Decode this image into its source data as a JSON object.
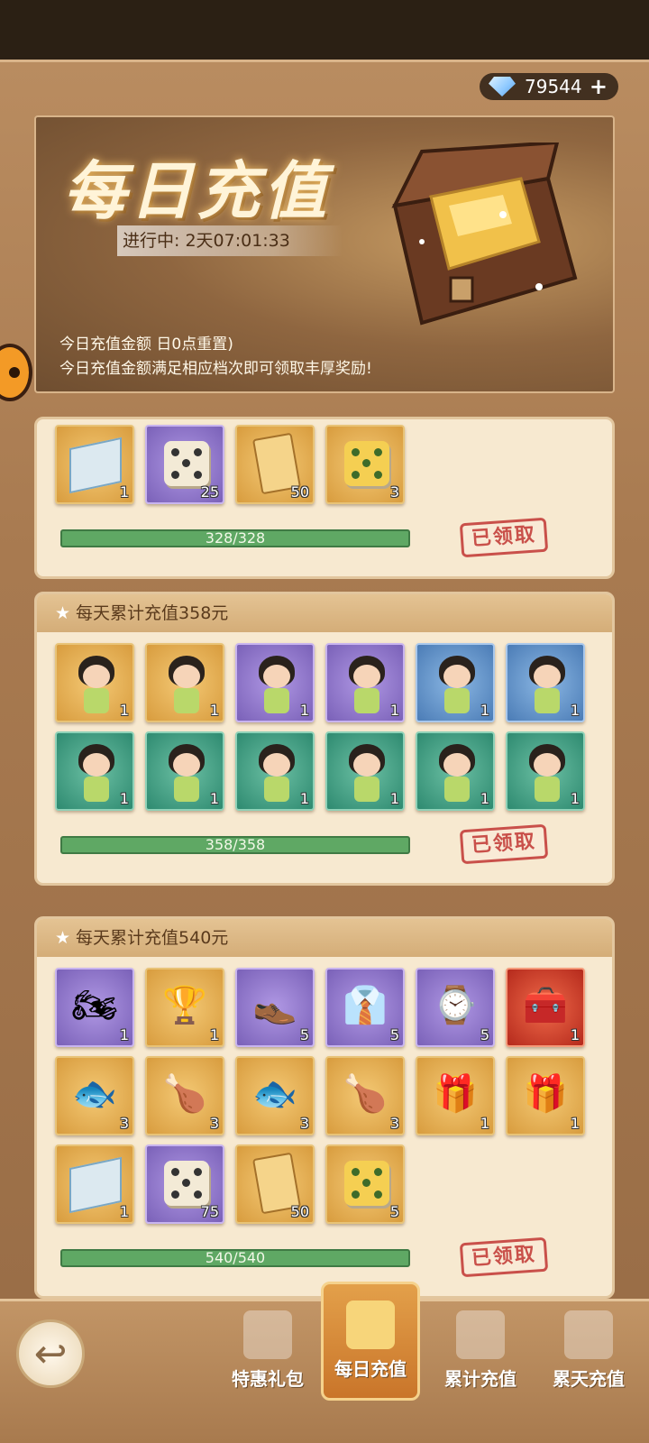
{
  "currency": {
    "gems": "79544",
    "plus": "+"
  },
  "banner": {
    "title": "每日充值",
    "timer": "进行中: 2天07:01:33",
    "line1": "今日充值金额      日0点重置)",
    "line2": "今日充值金额满足相应档次即可领取丰厚奖励!"
  },
  "tier1": {
    "items": [
      {
        "icon": "scroll-icon",
        "count": "1",
        "frame": "gold"
      },
      {
        "icon": "dice-icon",
        "count": "25",
        "frame": "purple"
      },
      {
        "icon": "fist-card-icon",
        "count": "50",
        "frame": "gold"
      },
      {
        "icon": "gold-dice-card-icon",
        "count": "3",
        "frame": "gold"
      }
    ],
    "progress": "328/328",
    "progress_fraction": 1.0,
    "status": "已领取"
  },
  "tier2": {
    "title": "每天累计充值358元",
    "items": [
      {
        "icon": "character-splash-icon",
        "count": "1",
        "frame": "gold"
      },
      {
        "icon": "character-splash-icon",
        "count": "1",
        "frame": "gold"
      },
      {
        "icon": "character-wave-icon",
        "count": "1",
        "frame": "purple"
      },
      {
        "icon": "character-wave-icon",
        "count": "1",
        "frame": "purple"
      },
      {
        "icon": "character-pose-icon",
        "count": "1",
        "frame": "blue"
      },
      {
        "icon": "character-pose-icon",
        "count": "1",
        "frame": "blue"
      },
      {
        "icon": "character-green-icon",
        "count": "1",
        "frame": "green"
      },
      {
        "icon": "character-green-icon",
        "count": "1",
        "frame": "green"
      },
      {
        "icon": "character-green-icon",
        "count": "1",
        "frame": "green"
      },
      {
        "icon": "character-green-icon",
        "count": "1",
        "frame": "green"
      },
      {
        "icon": "character-green-icon",
        "count": "1",
        "frame": "green"
      },
      {
        "icon": "character-green-icon",
        "count": "1",
        "frame": "green"
      }
    ],
    "progress": "358/358",
    "progress_fraction": 1.0,
    "status": "已领取"
  },
  "tier3": {
    "title": "每天累计充值540元",
    "items": [
      {
        "icon": "motorcycle-icon",
        "count": "1",
        "frame": "purple"
      },
      {
        "icon": "gold-ornament-icon",
        "count": "1",
        "frame": "gold"
      },
      {
        "icon": "shoes-icon",
        "count": "5",
        "frame": "purple"
      },
      {
        "icon": "suit-icon",
        "count": "5",
        "frame": "purple"
      },
      {
        "icon": "watch-icon",
        "count": "5",
        "frame": "purple"
      },
      {
        "icon": "treasure-chest-icon",
        "count": "1",
        "frame": "red"
      },
      {
        "icon": "fish-dish-icon",
        "count": "3",
        "frame": "gold"
      },
      {
        "icon": "chicken-dish-icon",
        "count": "3",
        "frame": "gold"
      },
      {
        "icon": "fish-dish-icon",
        "count": "3",
        "frame": "gold"
      },
      {
        "icon": "chicken-dish-icon",
        "count": "3",
        "frame": "gold"
      },
      {
        "icon": "gift-box-icon",
        "count": "1",
        "frame": "gold"
      },
      {
        "icon": "gift-box-icon",
        "count": "1",
        "frame": "gold"
      },
      {
        "icon": "scroll-icon",
        "count": "1",
        "frame": "gold"
      },
      {
        "icon": "dice-icon",
        "count": "75",
        "frame": "purple"
      },
      {
        "icon": "fist-card-icon",
        "count": "50",
        "frame": "gold"
      },
      {
        "icon": "gold-dice-card-icon",
        "count": "5",
        "frame": "gold"
      }
    ],
    "progress": "540/540",
    "progress_fraction": 1.0,
    "status": "已领取"
  },
  "nav": {
    "tabs": [
      {
        "label": "特惠礼包",
        "icon": "gift-icon"
      },
      {
        "label": "每日充值",
        "icon": "gold-bars-icon",
        "active": true
      },
      {
        "label": "累计充值",
        "icon": "chest-icon"
      },
      {
        "label": "累天充值",
        "icon": "calendar-icon"
      }
    ]
  },
  "colors": {
    "accent": "#d89c3e",
    "claimed": "#c9504a",
    "progress": "#5fa864"
  }
}
